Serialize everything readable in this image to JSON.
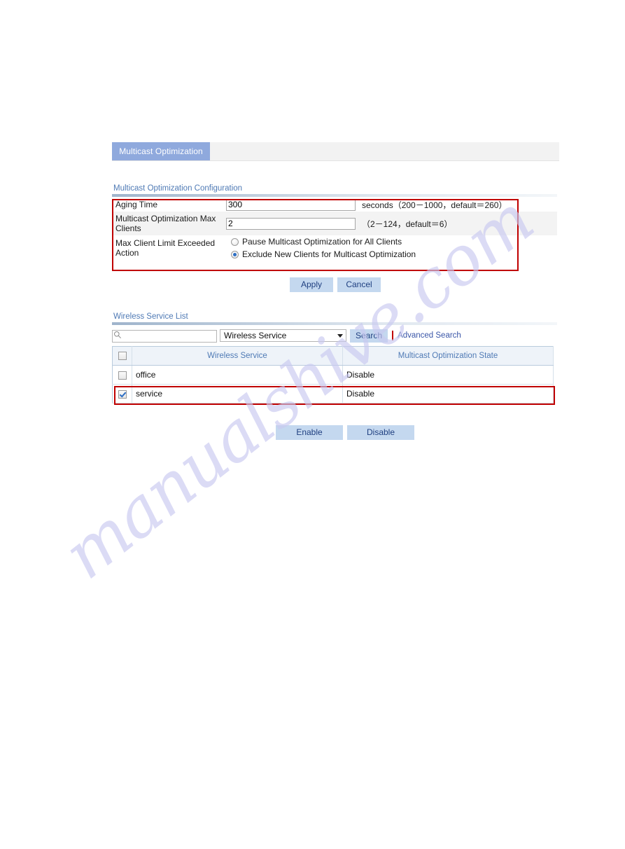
{
  "tabs": [
    {
      "label": "Multicast Optimization",
      "active": true
    }
  ],
  "config": {
    "section_title": "Multicast Optimization Configuration",
    "rows": [
      {
        "label": "Aging Time",
        "value": "300",
        "hint": "seconds（200－1000，default＝260）"
      },
      {
        "label": "Multicast Optimization Max Clients",
        "value": "2",
        "hint": "（2－124，default＝6）"
      }
    ],
    "action_label": "Max Client Limit Exceeded Action",
    "radios": [
      {
        "label": "Pause Multicast Optimization for All Clients",
        "checked": false
      },
      {
        "label": "Exclude New Clients for Multicast Optimization",
        "checked": true
      }
    ],
    "apply_label": "Apply",
    "cancel_label": "Cancel"
  },
  "list": {
    "section_title": "Wireless Service List",
    "search": {
      "value": "",
      "placeholder": "",
      "icon": "search-icon",
      "filter_value": "Wireless Service",
      "filter_options": [
        "Wireless Service"
      ],
      "search_button": "Search",
      "advanced_link": "Advanced Search"
    },
    "table": {
      "columns": [
        "",
        "Wireless Service",
        "Multicast Optimization State"
      ],
      "rows": [
        {
          "checked": false,
          "service": "office",
          "state": "Disable"
        },
        {
          "checked": true,
          "service": "service",
          "state": "Disable"
        }
      ],
      "header_checked": false
    },
    "enable_label": "Enable",
    "disable_label": "Disable"
  },
  "watermark": {
    "text": "manualshive.com"
  },
  "colors": {
    "tab_active_bg": "#8fa9dd",
    "section_title": "#4f7ab5",
    "button_bg": "#c4d8ef",
    "button_text": "#1f3f80",
    "highlight_border": "#c00000",
    "link": "#3a56a8"
  }
}
